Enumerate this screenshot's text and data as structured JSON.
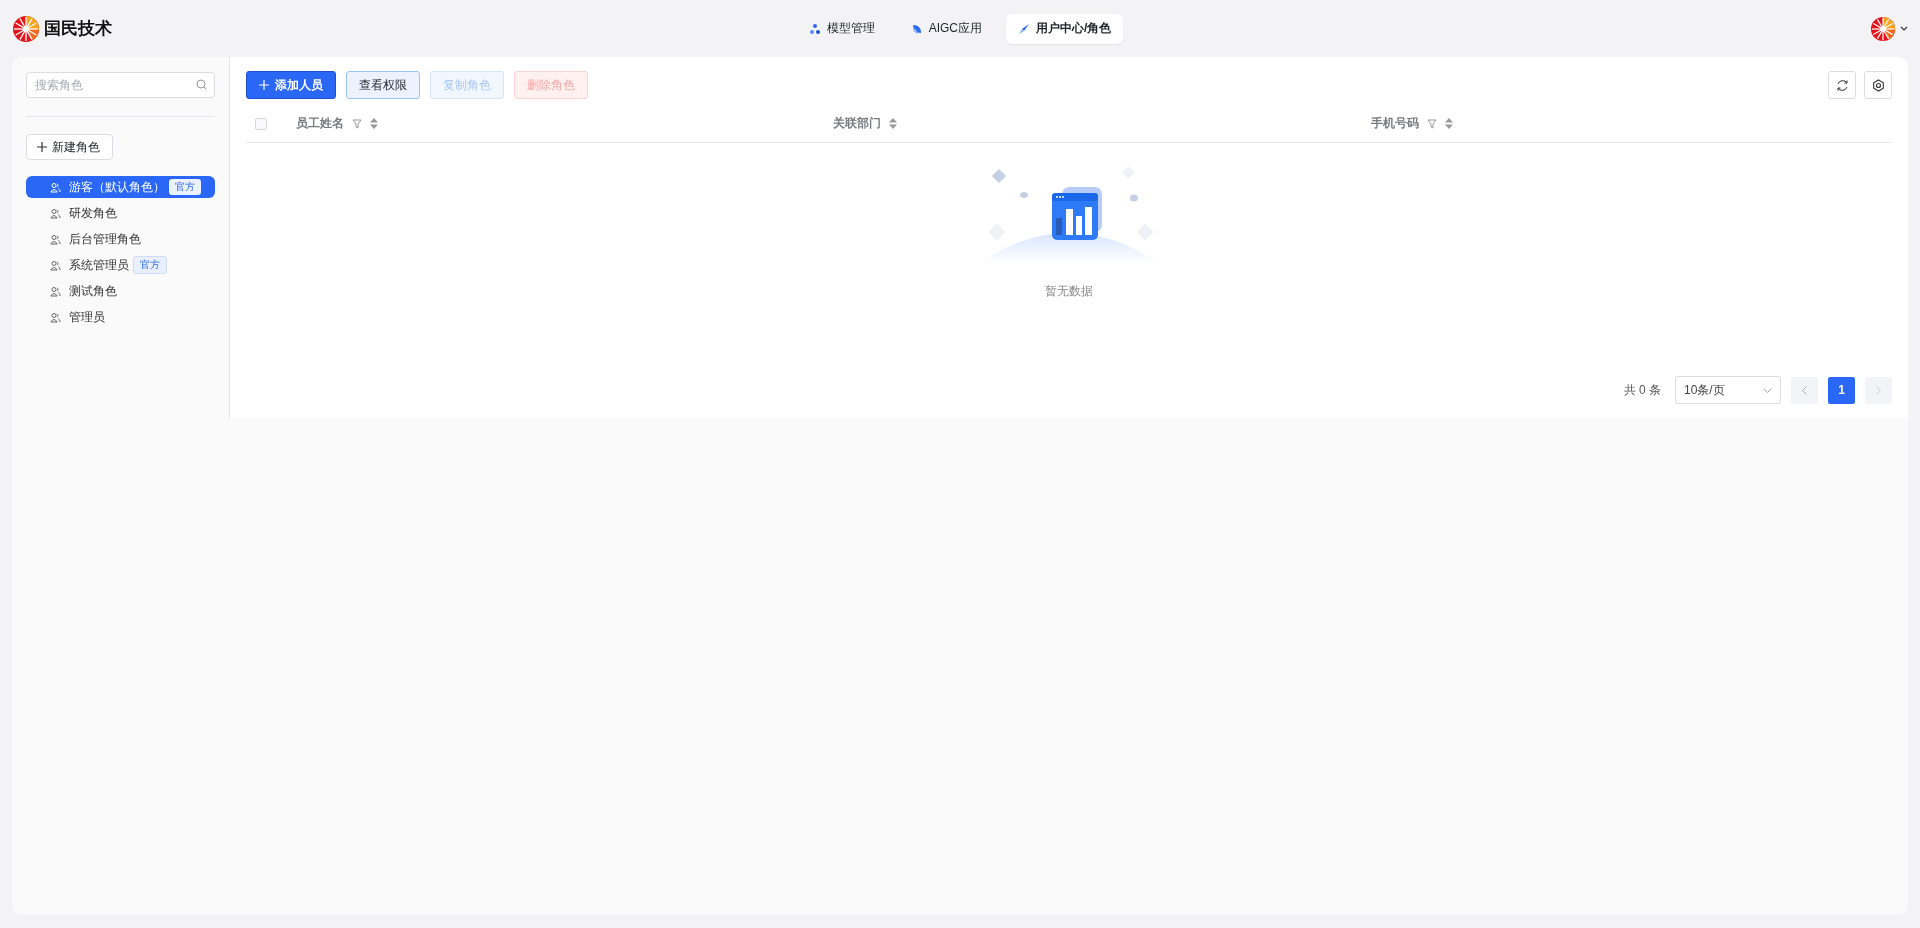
{
  "brand": {
    "name": "国民技术"
  },
  "nav": [
    {
      "label": "模型管理",
      "selected": false
    },
    {
      "label": "AIGC应用",
      "selected": false
    },
    {
      "label": "用户中心/角色",
      "selected": true
    }
  ],
  "sidebar": {
    "search": {
      "placeholder": "搜索角色"
    },
    "new_button": "新建角色",
    "roles": [
      {
        "name": "游客（默认角色）",
        "badge": "官方",
        "selected": true
      },
      {
        "name": "研发角色",
        "selected": false
      },
      {
        "name": "后台管理角色",
        "selected": false
      },
      {
        "name": "系统管理员",
        "badge": "官方",
        "selected": false
      },
      {
        "name": "测试角色",
        "selected": false
      },
      {
        "name": "管理员",
        "selected": false
      }
    ]
  },
  "toolbar": {
    "buttons": [
      {
        "label": "添加人员",
        "kind": "primary",
        "disabled": false
      },
      {
        "label": "查看权限",
        "kind": "secondary",
        "disabled": false
      },
      {
        "label": "复制角色",
        "kind": "secondary",
        "disabled": true
      },
      {
        "label": "删除角色",
        "kind": "danger",
        "disabled": true
      }
    ]
  },
  "table": {
    "select_all": {
      "checked": false
    },
    "columns": [
      {
        "label": "员工姓名",
        "filter": true
      },
      {
        "label": "关联部门",
        "filter": false
      },
      {
        "label": "手机号码",
        "filter": true
      }
    ],
    "empty_text": "暂无数据"
  },
  "pagination": {
    "total": "共 0 条",
    "page_size": "10条/页",
    "pages": [
      {
        "label": "1",
        "selected": true
      }
    ]
  }
}
